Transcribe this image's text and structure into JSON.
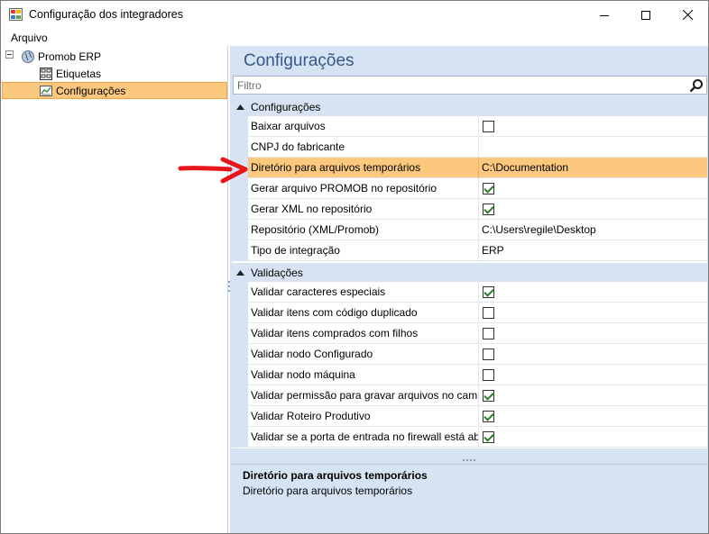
{
  "window": {
    "title": "Configuração dos integradores"
  },
  "menu": {
    "file_label": "Arquivo"
  },
  "tree": {
    "root_label": "Promob ERP",
    "items": [
      {
        "label": "Etiquetas"
      },
      {
        "label": "Configurações",
        "selected": true
      }
    ]
  },
  "main": {
    "heading": "Configurações",
    "filter_placeholder": "Filtro",
    "categories": [
      {
        "label": "Configurações",
        "properties": [
          {
            "name": "Baixar arquivos",
            "type": "checkbox",
            "checked": false
          },
          {
            "name": "CNPJ do fabricante",
            "type": "text",
            "value": ""
          },
          {
            "name": "Diretório para arquivos temporários",
            "type": "text",
            "value": "C:\\Documentation",
            "selected": true
          },
          {
            "name": "Gerar arquivo PROMOB no repositório",
            "type": "checkbox",
            "checked": true
          },
          {
            "name": "Gerar XML no repositório",
            "type": "checkbox",
            "checked": true
          },
          {
            "name": "Repositório (XML/Promob)",
            "type": "text",
            "value": "C:\\Users\\regile\\Desktop"
          },
          {
            "name": "Tipo de integração",
            "type": "text",
            "value": "ERP"
          }
        ]
      },
      {
        "label": "Validações",
        "properties": [
          {
            "name": "Validar caracteres especiais",
            "type": "checkbox",
            "checked": true
          },
          {
            "name": "Validar itens com código duplicado",
            "type": "checkbox",
            "checked": false
          },
          {
            "name": "Validar itens comprados com filhos",
            "type": "checkbox",
            "checked": false
          },
          {
            "name": "Validar nodo Configurado",
            "type": "checkbox",
            "checked": false
          },
          {
            "name": "Validar nodo máquina",
            "type": "checkbox",
            "checked": false
          },
          {
            "name": "Validar permissão para gravar arquivos no cami...",
            "type": "checkbox",
            "checked": true
          },
          {
            "name": "Validar Roteiro Produtivo",
            "type": "checkbox",
            "checked": true
          },
          {
            "name": "Validar se a porta de entrada no firewall está ab...",
            "type": "checkbox",
            "checked": true
          }
        ]
      }
    ]
  },
  "description": {
    "title": "Diretório para arquivos temporários",
    "body": "Diretório para arquivos temporários"
  },
  "colors": {
    "selection": "#fbc87e",
    "panel_background": "#d6e3f3",
    "heading": "#355a8a",
    "annotation_arrow": "#e8151b"
  }
}
